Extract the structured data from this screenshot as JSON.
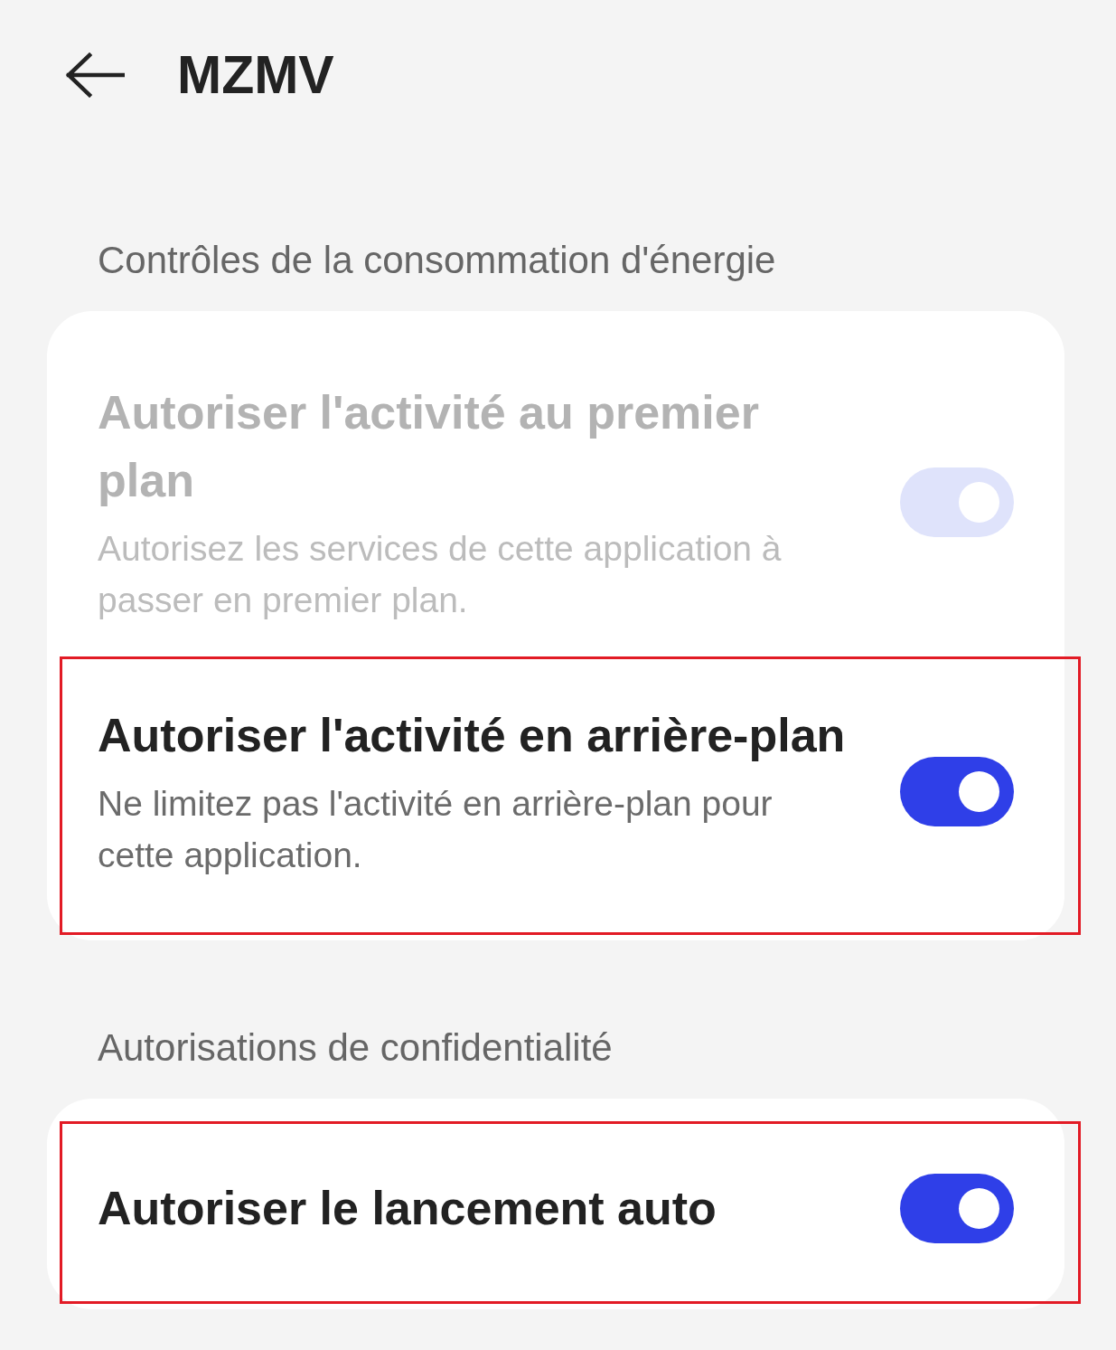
{
  "header": {
    "title": "MZMV"
  },
  "sections": [
    {
      "heading": "Contrôles de la consommation d'énergie",
      "settings": [
        {
          "title": "Autoriser l'activité au premier plan",
          "description": "Autorisez les services de cette application à passer en premier plan.",
          "on": true,
          "disabled": true,
          "highlighted": false
        },
        {
          "title": "Autoriser l'activité en arrière-plan",
          "description": "Ne limitez pas l'activité en arrière-plan pour cette application.",
          "on": true,
          "disabled": false,
          "highlighted": true
        }
      ]
    },
    {
      "heading": "Autorisations de confidentialité",
      "settings": [
        {
          "title": "Autoriser le lancement auto",
          "on": true,
          "disabled": false,
          "highlighted": true
        }
      ]
    }
  ]
}
